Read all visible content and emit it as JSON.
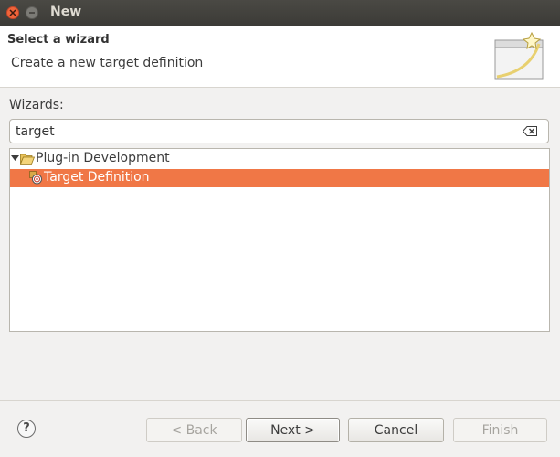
{
  "window": {
    "title": "New"
  },
  "banner": {
    "title": "Select a wizard",
    "description": "Create a new target definition"
  },
  "wizards_label": "Wizards:",
  "filter": {
    "value": "target",
    "clear_icon": "clear-filter-icon"
  },
  "tree": {
    "category": {
      "label": "Plug-in Development",
      "icon": "folder-open-icon",
      "expanded": true
    },
    "item": {
      "label": "Target Definition",
      "icon": "target-definition-icon",
      "selected": true
    }
  },
  "buttons": {
    "back": "< Back",
    "next": "Next >",
    "cancel": "Cancel",
    "finish": "Finish"
  },
  "help": {
    "label": "?"
  },
  "colors": {
    "selection": "#f07746",
    "titlebar": "#3c3b37",
    "close_button": "#f0643a"
  }
}
